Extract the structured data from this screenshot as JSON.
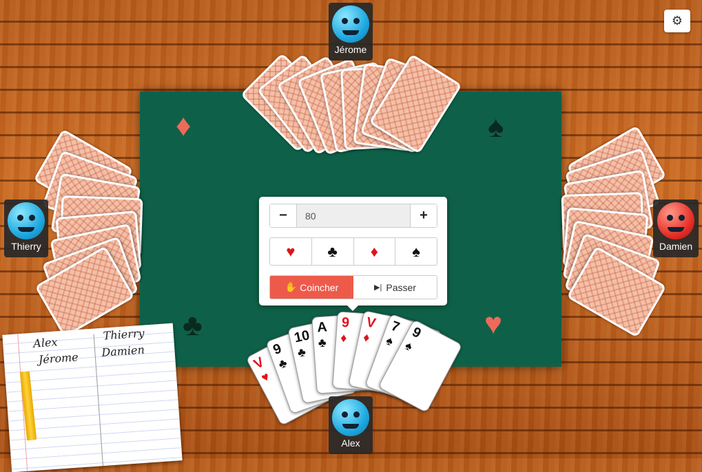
{
  "players": {
    "top": {
      "name": "Jérome"
    },
    "left": {
      "name": "Thierry"
    },
    "right": {
      "name": "Damien"
    },
    "bottom": {
      "name": "Alex"
    }
  },
  "bid_panel": {
    "value": "80",
    "minus_icon": "minus-icon",
    "plus_icon": "plus-icon",
    "suits": [
      {
        "symbol": "♥",
        "color": "#e0121b"
      },
      {
        "symbol": "♣",
        "color": "#111111"
      },
      {
        "symbol": "♦",
        "color": "#e0121b"
      },
      {
        "symbol": "♠",
        "color": "#111111"
      }
    ],
    "coinche_label": "Coincher",
    "passer_label": "Passer"
  },
  "hand": [
    {
      "rank": "V",
      "suit": "♥",
      "color": "red"
    },
    {
      "rank": "9",
      "suit": "♣",
      "color": "black"
    },
    {
      "rank": "10",
      "suit": "♣",
      "color": "black"
    },
    {
      "rank": "A",
      "suit": "♣",
      "color": "black"
    },
    {
      "rank": "9",
      "suit": "♦",
      "color": "red"
    },
    {
      "rank": "V",
      "suit": "♦",
      "color": "red"
    },
    {
      "rank": "7",
      "suit": "♠",
      "color": "black"
    },
    {
      "rank": "9",
      "suit": "♠",
      "color": "black"
    }
  ],
  "scoresheet": {
    "team1": [
      "Alex",
      "Jérome"
    ],
    "team2": [
      "Thierry",
      "Damien"
    ]
  },
  "table_suits": {
    "top_left": "♦",
    "top_right": "♠",
    "bottom_left": "♣",
    "bottom_right": "♥"
  },
  "settings_icon": "gear-icon"
}
